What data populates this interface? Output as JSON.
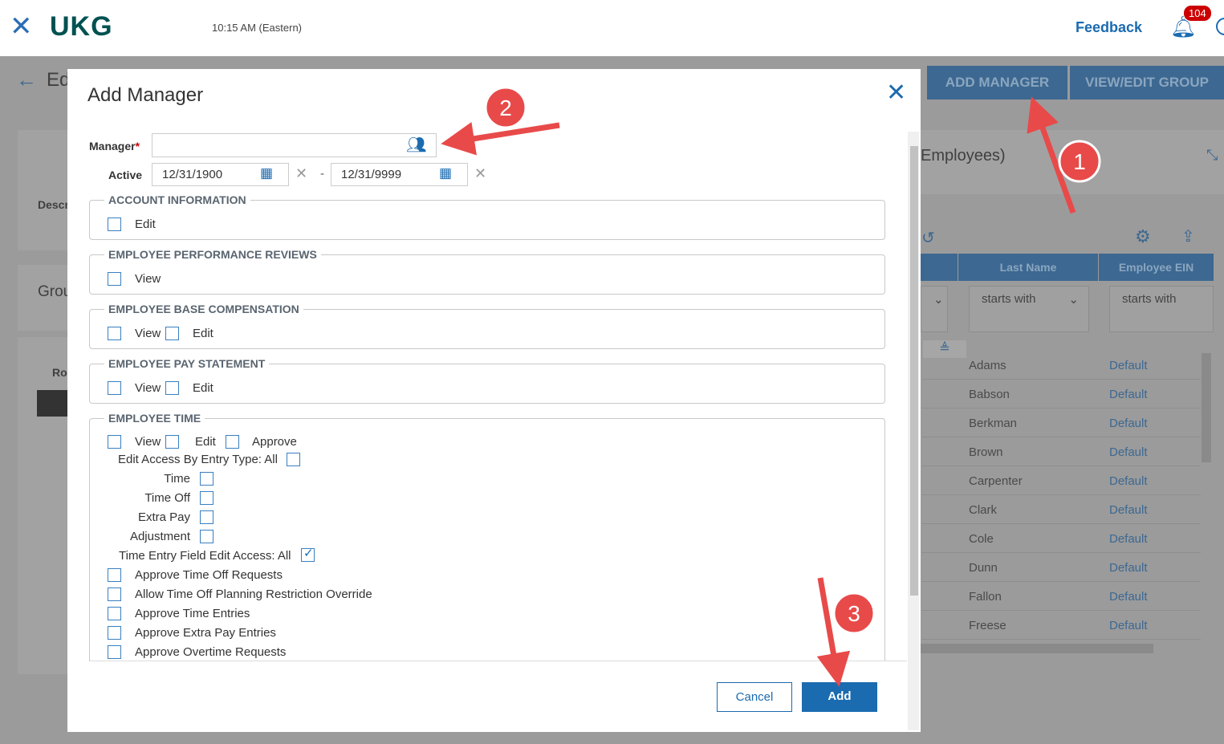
{
  "topbar": {
    "logo": "UKG",
    "time": "10:15 AM (Eastern)",
    "feedback": "Feedback",
    "notifications": "104"
  },
  "background": {
    "back_title": "Ed",
    "buttons": [
      "ADD MANAGER",
      "VIEW/EDIT GROUP"
    ],
    "panel_title": "Employees)",
    "desc_label": "Descr",
    "group_label": "Grou",
    "ro_label": "Ro",
    "columns": [
      "Last Name",
      "Employee EIN"
    ],
    "filter": "starts with",
    "rows": [
      [
        "Adams",
        "Default"
      ],
      [
        "Babson",
        "Default"
      ],
      [
        "Berkman",
        "Default"
      ],
      [
        "Brown",
        "Default"
      ],
      [
        "Carpenter",
        "Default"
      ],
      [
        "Clark",
        "Default"
      ],
      [
        "Cole",
        "Default"
      ],
      [
        "Dunn",
        "Default"
      ],
      [
        "Fallon",
        "Default"
      ],
      [
        "Freese",
        "Default"
      ]
    ]
  },
  "modal": {
    "title": "Add Manager",
    "manager_label": "Manager",
    "required": "*",
    "manager_value": "",
    "active_label": "Active",
    "start_date": "12/31/1900",
    "end_date": "12/31/9999",
    "dash": "-",
    "sections": [
      {
        "legend": "ACCOUNT INFORMATION",
        "options": [
          {
            "label": "Edit",
            "checked": false
          }
        ]
      },
      {
        "legend": "EMPLOYEE PERFORMANCE REVIEWS",
        "options": [
          {
            "label": "View",
            "checked": false
          }
        ]
      },
      {
        "legend": "EMPLOYEE BASE COMPENSATION",
        "options": [
          {
            "label": "View",
            "checked": false
          },
          {
            "label": "Edit",
            "checked": false
          }
        ]
      },
      {
        "legend": "EMPLOYEE PAY STATEMENT",
        "options": [
          {
            "label": "View",
            "checked": false
          },
          {
            "label": "Edit",
            "checked": false
          }
        ]
      }
    ],
    "employee_time": {
      "legend": "EMPLOYEE TIME",
      "top": [
        {
          "label": "View",
          "checked": false
        },
        {
          "label": "Edit",
          "checked": false
        },
        {
          "label": "Approve",
          "checked": false
        }
      ],
      "entry_type_all": "Edit Access By Entry Type: All",
      "entry_types": [
        {
          "label": "Time",
          "checked": false
        },
        {
          "label": "Time Off",
          "checked": false
        },
        {
          "label": "Extra Pay",
          "checked": false
        },
        {
          "label": "Adjustment",
          "checked": false
        }
      ],
      "field_edit_all": "Time Entry Field Edit Access: All",
      "field_edit_checked": true,
      "list": [
        {
          "label": "Approve Time Off Requests",
          "checked": false
        },
        {
          "label": "Allow Time Off Planning Restriction Override",
          "checked": false
        },
        {
          "label": "Approve Time Entries",
          "checked": false
        },
        {
          "label": "Approve Extra Pay Entries",
          "checked": false
        },
        {
          "label": "Approve Overtime Requests",
          "checked": false
        }
      ]
    },
    "cancel": "Cancel",
    "add": "Add"
  },
  "annotations": [
    "1",
    "2",
    "3"
  ],
  "colors": {
    "accent": "#1b6bb0",
    "annotation": "#e84a4a",
    "add_button": "#1b6bb0"
  }
}
